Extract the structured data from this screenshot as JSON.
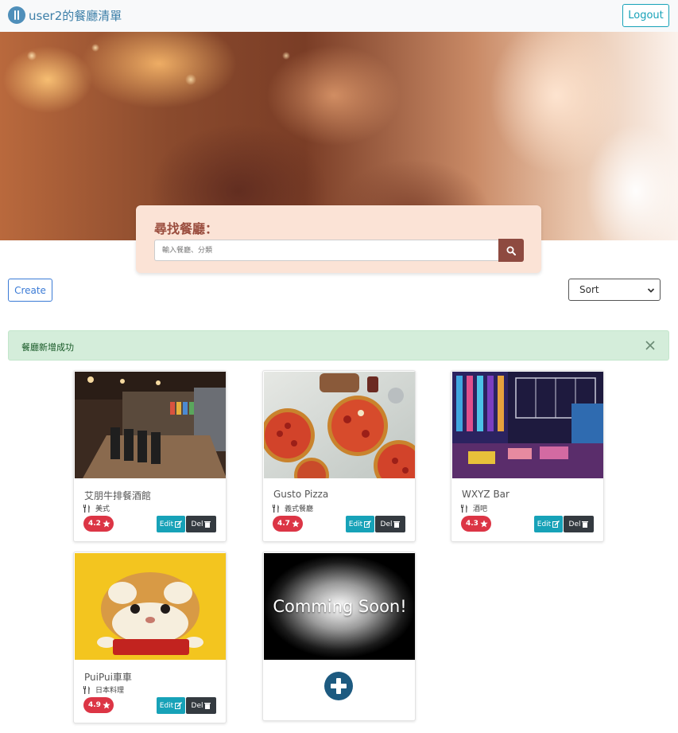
{
  "navbar": {
    "brand_text": "user2的餐廳清單",
    "logout_label": "Logout",
    "brand_color": "#3d7fa8"
  },
  "search": {
    "title": "尋找餐廳：",
    "placeholder": "輸入餐廳、分類",
    "button_icon": "search-icon"
  },
  "toolbar": {
    "create_label": "Create",
    "sort_selected": "Sort"
  },
  "alert": {
    "message": "餐廳新增成功",
    "close_icon": "close-icon"
  },
  "restaurants": [
    {
      "name": "艾朋牛排餐酒館",
      "category": "美式",
      "rating": "4.2",
      "edit_label": "Edit",
      "del_label": "Del"
    },
    {
      "name": "Gusto Pizza",
      "category": "義式餐廳",
      "rating": "4.7",
      "edit_label": "Edit",
      "del_label": "Del"
    },
    {
      "name": "WXYZ Bar",
      "category": "酒吧",
      "rating": "4.3",
      "edit_label": "Edit",
      "del_label": "Del"
    },
    {
      "name": "PuiPui車車",
      "category": "日本料理",
      "rating": "4.9",
      "edit_label": "Edit",
      "del_label": "Del"
    }
  ],
  "coming_soon": {
    "label": "Comming Soon!",
    "add_icon": "plus-circle-icon"
  },
  "colors": {
    "rating_badge": "#dc3545",
    "edit_button": "#17a2b8",
    "del_button": "#343a40",
    "search_button": "#8e4a40",
    "alert_bg": "#d4edda"
  }
}
